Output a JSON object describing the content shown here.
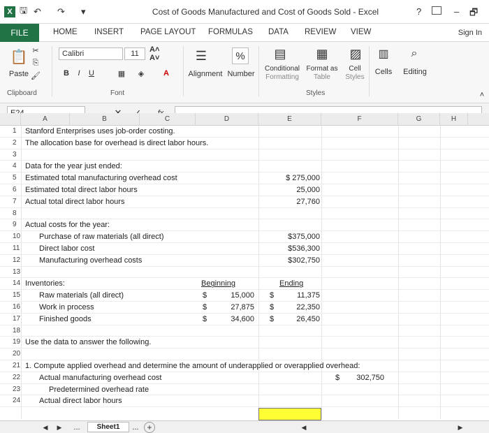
{
  "title": "Cost of Goods Manufactured and Cost of Goods Sold - Excel",
  "window_controls": {
    "help": "?",
    "minimize": "–",
    "restore": "🗗"
  },
  "tabs": [
    {
      "label": "FILE",
      "active": true
    },
    {
      "label": "HOME"
    },
    {
      "label": "INSERT"
    },
    {
      "label": "PAGE LAYOUT"
    },
    {
      "label": "FORMULAS"
    },
    {
      "label": "DATA"
    },
    {
      "label": "REVIEW"
    },
    {
      "label": "VIEW"
    }
  ],
  "signin": "Sign In",
  "ribbon": {
    "paste": "Paste",
    "clipboard": "Clipboard",
    "font_name": "Calibri",
    "font_size": "11",
    "font_group": "Font",
    "bold": "B",
    "italic": "I",
    "underline": "U",
    "alignment": "Alignment",
    "number": "Number",
    "percent": "%",
    "conditional_formatting": [
      "Conditional",
      "Formatting"
    ],
    "format_as_table": [
      "Format as",
      "Table"
    ],
    "cell_styles": [
      "Cell",
      "Styles"
    ],
    "styles_group": "Styles",
    "cells": "Cells",
    "editing": "Editing"
  },
  "namebox": "E24",
  "fx": "fx",
  "columns": [
    "A",
    "B",
    "C",
    "D",
    "E",
    "F",
    "G",
    "H"
  ],
  "rows": [
    {
      "n": "1",
      "a": "Stanford Enterprises uses job-order costing."
    },
    {
      "n": "2",
      "a": "The allocation base for overhead is direct labor hours."
    },
    {
      "n": "3"
    },
    {
      "n": "4",
      "a": "Data for the year just ended:"
    },
    {
      "n": "5",
      "a": "Estimated total manufacturing overhead cost",
      "e": "$ 275,000"
    },
    {
      "n": "6",
      "a": "Estimated total direct labor hours",
      "e": "25,000"
    },
    {
      "n": "7",
      "a": "Actual total direct labor hours",
      "e": "27,760"
    },
    {
      "n": "8"
    },
    {
      "n": "9",
      "a": "Actual costs for the year:"
    },
    {
      "n": "10",
      "a2": "Purchase of raw materials (all direct)",
      "e": "$375,000"
    },
    {
      "n": "11",
      "a2": "Direct labor cost",
      "e": "$536,300"
    },
    {
      "n": "12",
      "a2": "Manufacturing overhead costs",
      "e": "$302,750"
    },
    {
      "n": "13"
    },
    {
      "n": "14",
      "a": "Inventories:",
      "d": "Beginning",
      "e": "Ending"
    },
    {
      "n": "15",
      "a2": "Raw materials (all direct)",
      "dcur": "$",
      "d": "15,000",
      "ecur": "$",
      "e": "11,375"
    },
    {
      "n": "16",
      "a2": "Work in process",
      "dcur": "$",
      "d": "27,875",
      "ecur": "$",
      "e": "22,350"
    },
    {
      "n": "17",
      "a2": "Finished goods",
      "dcur": "$",
      "d": "34,600",
      "ecur": "$",
      "e": "26,450"
    },
    {
      "n": "18"
    },
    {
      "n": "19",
      "a": "Use the data to answer the following."
    },
    {
      "n": "20"
    },
    {
      "n": "21",
      "a": "1. Compute applied overhead and determine the amount of underapplied or overapplied overhead:"
    },
    {
      "n": "22",
      "a2": "Actual manufacturing overhead cost",
      "fcur": "$",
      "f": "302,750"
    },
    {
      "n": "23",
      "a3": "Predetermined overhead rate"
    },
    {
      "n": "24",
      "a2": "Actual direct labor hours"
    }
  ],
  "sheet_tab": "Sheet1",
  "more_sheets": "..."
}
